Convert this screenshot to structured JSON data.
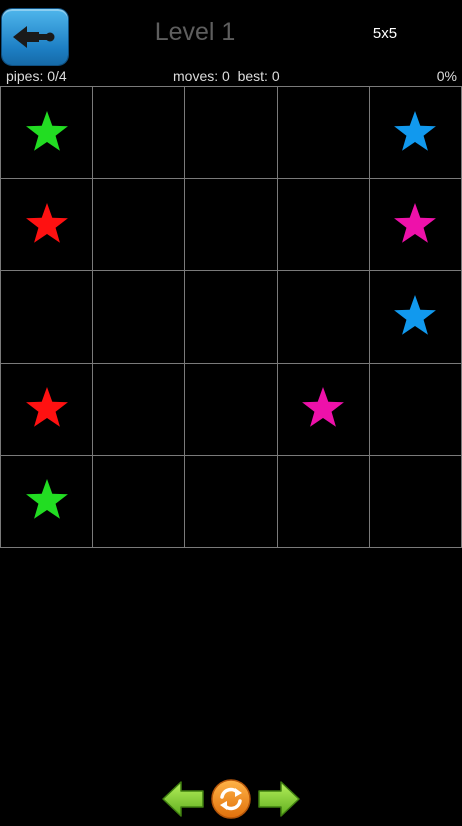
{
  "header": {
    "back_icon": "back-arrow-icon",
    "title": "Level 1",
    "grid_size": "5x5"
  },
  "stats": {
    "pipes": "pipes: 0/4",
    "moves": "moves: 0  best: 0",
    "percent": "0%"
  },
  "colors": {
    "green": "#22dd22",
    "blue": "#1199ee",
    "red": "#ff1111",
    "magenta": "#ee11aa",
    "grid_line": "#7a7a7a",
    "back_button": "#2a8fd6",
    "arrow_green": "#8ed43a",
    "refresh_orange": "#f28a1a"
  },
  "board": {
    "rows": 5,
    "cols": 5,
    "cells": [
      [
        "green",
        "",
        "",
        "",
        "blue"
      ],
      [
        "red",
        "",
        "",
        "",
        "magenta"
      ],
      [
        "",
        "",
        "",
        "",
        "blue"
      ],
      [
        "red",
        "",
        "",
        "magenta",
        ""
      ],
      [
        "green",
        "",
        "",
        "",
        ""
      ]
    ]
  },
  "controls": {
    "prev_icon": "left-arrow-icon",
    "refresh_icon": "refresh-icon",
    "next_icon": "right-arrow-icon"
  }
}
